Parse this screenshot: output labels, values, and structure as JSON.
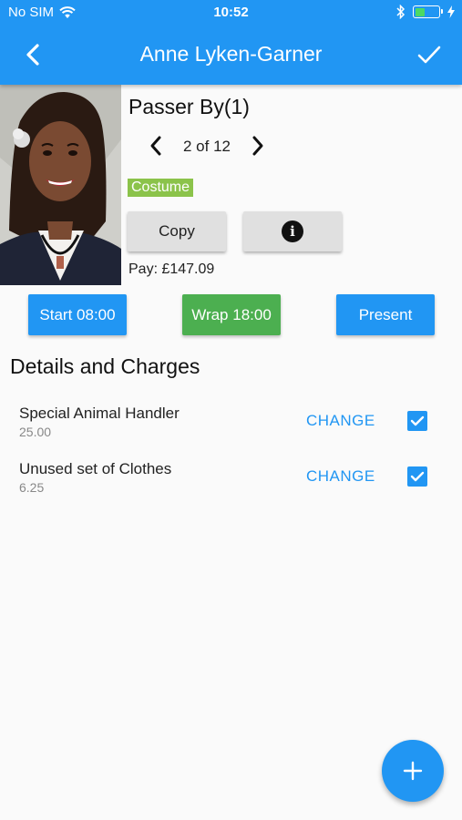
{
  "status_bar": {
    "carrier": "No SIM",
    "time": "10:52",
    "battery_level": 0.45
  },
  "header": {
    "title": "Anne Lyken-Garner",
    "back_icon": "chevron-left-icon",
    "confirm_icon": "check-icon"
  },
  "profile": {
    "role": "Passer By(1)",
    "pager": "2 of 12",
    "badge": "Costume",
    "copy_label": "Copy",
    "info_icon": "info-icon",
    "pay": "Pay: £147.09"
  },
  "time_buttons": {
    "start": "Start 08:00",
    "wrap": "Wrap 18:00",
    "present": "Present"
  },
  "details": {
    "title": "Details and Charges",
    "items": [
      {
        "name": "Special Animal Handler",
        "amount": "25.00",
        "action": "CHANGE",
        "checked": true
      },
      {
        "name": "Unused set of Clothes",
        "amount": "6.25",
        "action": "CHANGE",
        "checked": true
      }
    ]
  },
  "fab_icon": "plus-icon",
  "colors": {
    "primary": "#2196f3",
    "success": "#4caf50",
    "badge": "#8bc34a",
    "grey_button": "#e0e0e0"
  }
}
